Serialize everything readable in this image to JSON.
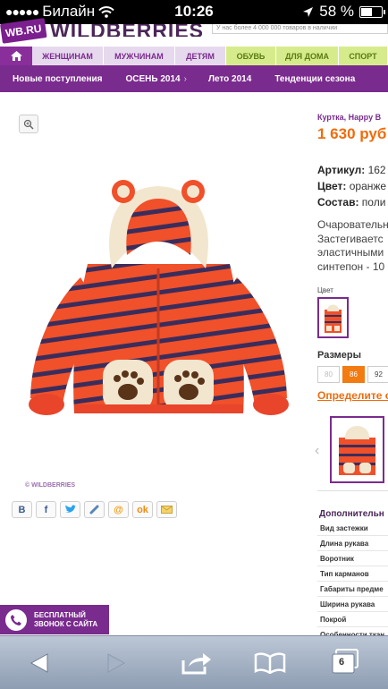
{
  "status_bar": {
    "carrier": "Билайн",
    "time": "10:26",
    "battery_percent": "58 %",
    "battery_level": 0.58
  },
  "header": {
    "logo_badge": "WB.RU",
    "logo_text": "WILDBERRIES",
    "search_hint": "У нас более 4 000 000 товаров в наличии"
  },
  "nav": {
    "tabs": [
      {
        "label": "ЖЕНЩИНАМ"
      },
      {
        "label": "МУЖЧИНАМ"
      },
      {
        "label": "ДЕТЯМ"
      },
      {
        "label": "ОБУВЬ"
      },
      {
        "label": "ДЛЯ ДОМА"
      },
      {
        "label": "СПОРТ"
      }
    ]
  },
  "subnav": {
    "items": [
      {
        "label": "Новые поступления"
      },
      {
        "label": "ОСЕНЬ 2014"
      },
      {
        "label": "Лето 2014"
      },
      {
        "label": "Тенденции сезона"
      }
    ]
  },
  "product": {
    "watermark": "© WILDBERRIES",
    "title": "Куртка, Happy B",
    "price": "1 630 руб",
    "article_label": "Артикул:",
    "article_value": "162",
    "color_label": "Цвет:",
    "color_value": "оранже",
    "composition_label": "Состав:",
    "composition_value": "поли",
    "description_lines": [
      "Очаровательн",
      "Застегиваетс",
      "эластичными",
      "синтепон - 10"
    ],
    "color_section_label": "Цвет",
    "sizes_label": "Размеры",
    "sizes": [
      {
        "label": "80",
        "state": "unavailable"
      },
      {
        "label": "86",
        "state": "selected"
      },
      {
        "label": "92",
        "state": "available"
      }
    ],
    "size_link": "Определите с",
    "extra_title": "Дополнительн",
    "extra_rows": [
      "Вид застежки",
      "Длина рукава",
      "Воротник",
      "Тип карманов",
      "Габариты предме",
      "Ширина рукава",
      "Покрой",
      "Особенности ткан"
    ]
  },
  "callback": {
    "line1": "БЕСПЛАТНЫЙ",
    "line2": "ЗВОНОК С САЙТА"
  },
  "toolbar": {
    "tabs_count": "6"
  },
  "colors": {
    "brand_purple": "#7a2b8e",
    "price_orange": "#ef6c0b",
    "jacket_red": "#f0502a"
  }
}
